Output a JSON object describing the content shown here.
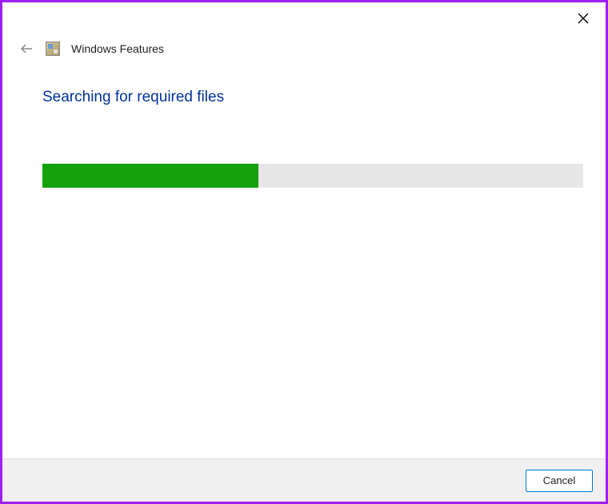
{
  "window": {
    "title": "Windows Features"
  },
  "content": {
    "status_heading": "Searching for required files",
    "progress_percent": 40
  },
  "buttons": {
    "cancel_label": "Cancel"
  }
}
